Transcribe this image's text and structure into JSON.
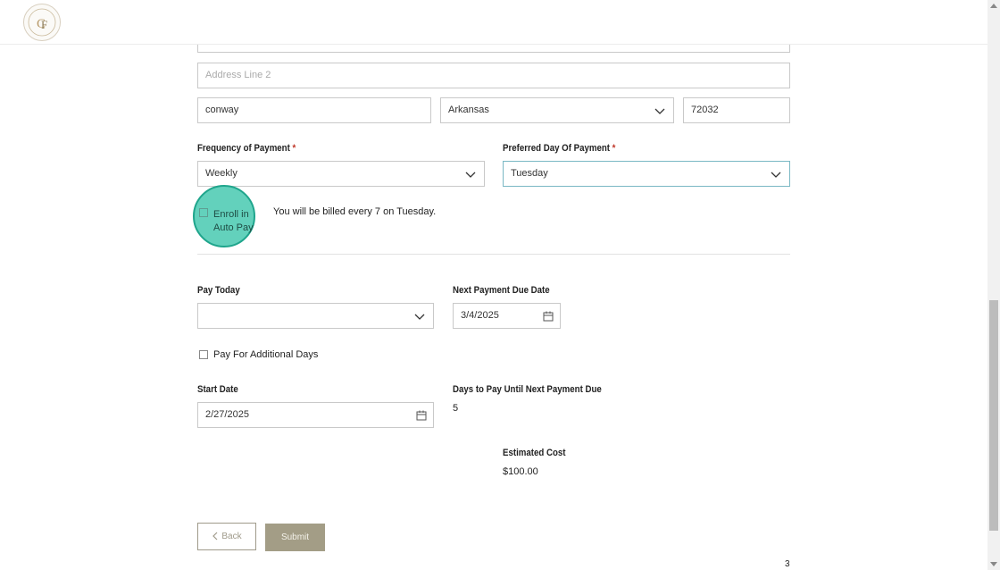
{
  "header": {
    "logo_icon": "city-of-faith-logo"
  },
  "address": {
    "line2_placeholder": "Address Line 2",
    "city": "conway",
    "state": "Arkansas",
    "zip": "72032"
  },
  "payment_frequency": {
    "label": "Frequency of Payment",
    "required_mark": "*",
    "value": "Weekly"
  },
  "preferred_day": {
    "label": "Preferred Day Of Payment",
    "required_mark": "*",
    "value": "Tuesday"
  },
  "autopay": {
    "label_line1": "Enroll in",
    "label_line2": "Auto Pay",
    "billing_note": "You will be billed every 7 on Tuesday."
  },
  "pay_today": {
    "label": "Pay Today",
    "value": ""
  },
  "next_due": {
    "label": "Next Payment Due Date",
    "value": "3/4/2025"
  },
  "additional_days": {
    "label": "Pay For Additional Days"
  },
  "start_date": {
    "label": "Start Date",
    "value": "2/27/2025"
  },
  "days_to_pay": {
    "label": "Days to Pay Until Next Payment Due",
    "value": "5"
  },
  "estimated_cost": {
    "label": "Estimated Cost",
    "value": "$100.00"
  },
  "buttons": {
    "back": "Back",
    "submit": "Submit"
  },
  "page_number": "3",
  "colors": {
    "accent": "#a39d86",
    "highlight": "#48c9b0",
    "required": "#c0392b"
  }
}
